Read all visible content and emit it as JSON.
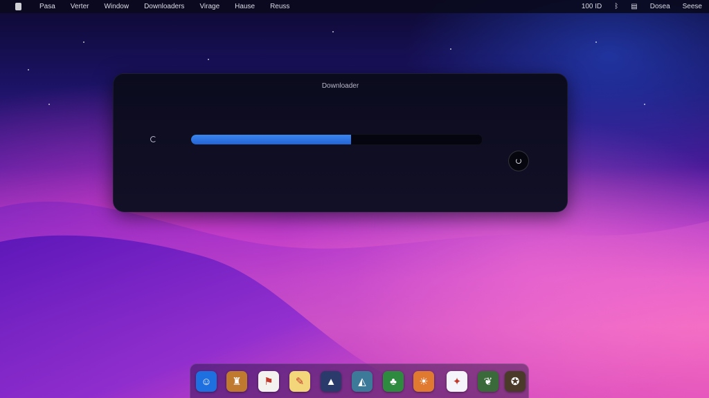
{
  "menubar": {
    "app_icon": "apple-icon",
    "items": [
      "Pasa",
      "Verter",
      "Window",
      "Downloaders",
      "Virage",
      "Hause",
      "Reuss"
    ],
    "status": {
      "battery_text": "100 ID",
      "icons": [
        "bluetooth-icon",
        "file-icon"
      ],
      "text_items": [
        "Dosea",
        "Seese"
      ]
    }
  },
  "hud": {
    "title": "Downloader",
    "progress": 0.55,
    "accent_color": "#2f7ae6",
    "left_icon": "spinner-icon",
    "button_icon": "stop-icon"
  },
  "dock": {
    "apps": [
      {
        "icon": "finder-icon",
        "glyph": "☺",
        "bg": "#1e6fe0"
      },
      {
        "icon": "game-icon",
        "glyph": "♜",
        "bg": "#c07a30"
      },
      {
        "icon": "document-icon",
        "glyph": "⚑",
        "bg": "#f4f2ee"
      },
      {
        "icon": "pencil-icon",
        "glyph": "✎",
        "bg": "#f3d67a"
      },
      {
        "icon": "photo-icon",
        "glyph": "▲",
        "bg": "#2a3a6a"
      },
      {
        "icon": "mountain-icon",
        "glyph": "◭",
        "bg": "#3d7a9a"
      },
      {
        "icon": "garden-icon",
        "glyph": "♣",
        "bg": "#2e8a3e"
      },
      {
        "icon": "sunset-icon",
        "glyph": "☀",
        "bg": "#e07a30"
      },
      {
        "icon": "bird-icon",
        "glyph": "✦",
        "bg": "#f4f4fa"
      },
      {
        "icon": "dragon-icon",
        "glyph": "❦",
        "bg": "#3a6a3a"
      },
      {
        "icon": "shield-icon",
        "glyph": "✪",
        "bg": "#4a3a2a"
      }
    ]
  }
}
